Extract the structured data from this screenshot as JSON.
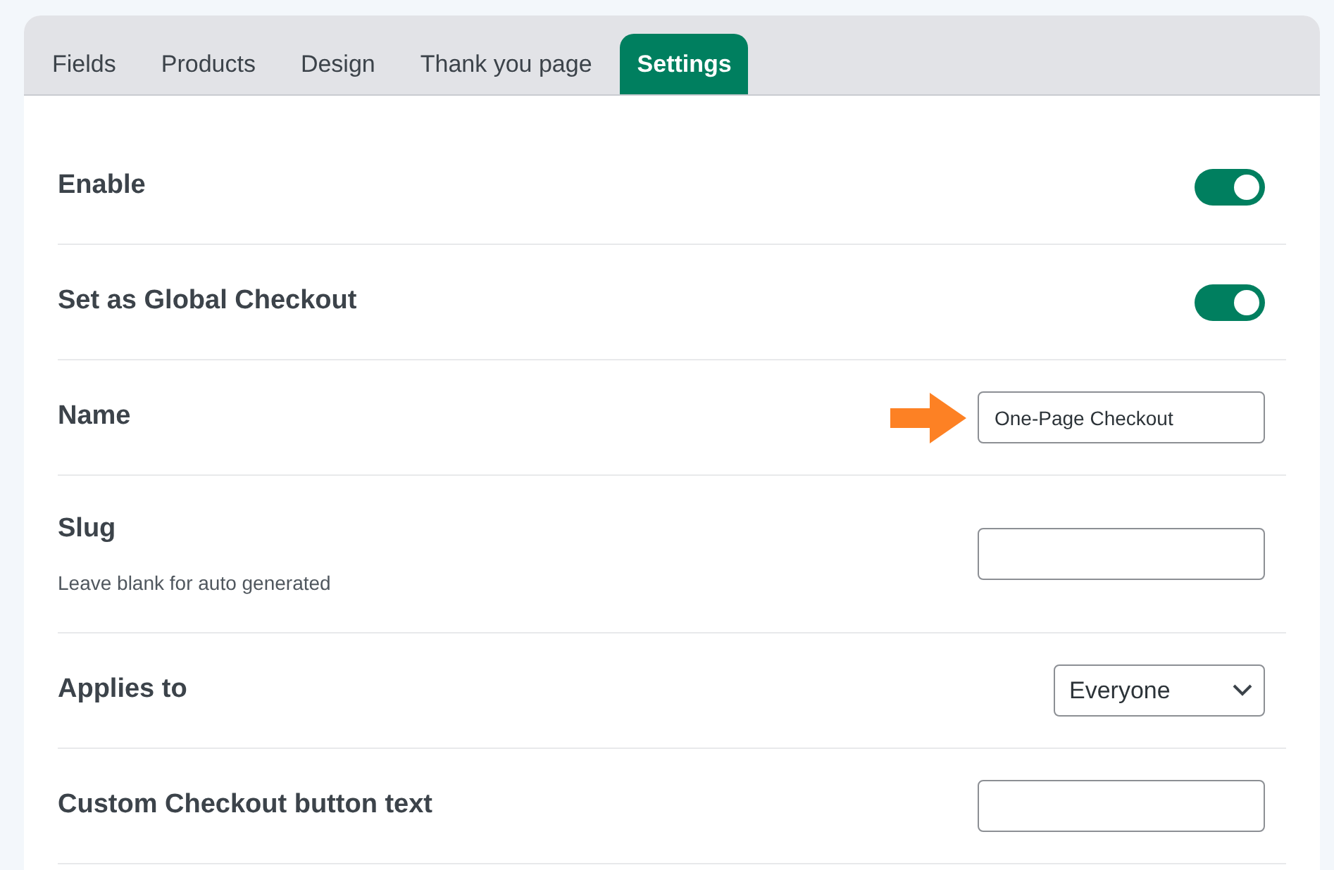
{
  "tabs": [
    {
      "label": "Fields",
      "selected": false
    },
    {
      "label": "Products",
      "selected": false
    },
    {
      "label": "Design",
      "selected": false
    },
    {
      "label": "Thank you page",
      "selected": false
    },
    {
      "label": "Settings",
      "selected": true
    }
  ],
  "settings": [
    {
      "kind": "toggle",
      "label": "Enable",
      "on": true,
      "arrow": false
    },
    {
      "kind": "toggle",
      "label": "Set as Global Checkout",
      "on": true,
      "arrow": false
    },
    {
      "kind": "text",
      "label": "Name",
      "value": "One-Page Checkout",
      "arrow": true
    },
    {
      "kind": "text",
      "label": "Slug",
      "hint": "Leave blank for auto generated",
      "arrow": false
    },
    {
      "kind": "select",
      "label": "Applies to",
      "value": "Everyone",
      "arrow": false
    },
    {
      "kind": "text",
      "label": "Custom Checkout button text",
      "arrow": false
    }
  ]
}
